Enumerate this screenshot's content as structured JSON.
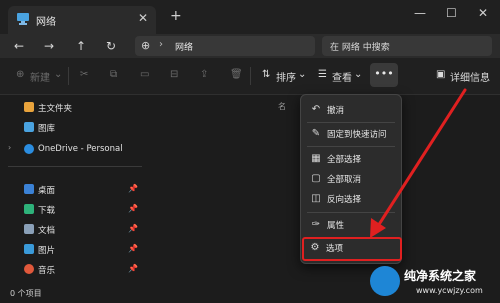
{
  "window": {
    "tab_title": "网络",
    "tab_icon": "network-icon",
    "new_tab": "+",
    "controls": {
      "minimize": "—",
      "maximize": "☐",
      "close": "✕"
    }
  },
  "address": {
    "path": "网络",
    "search_placeholder": "在 网络 中搜索"
  },
  "toolbar": {
    "new_label": "新建",
    "sort_label": "排序",
    "view_label": "查看",
    "more_label": "•••",
    "details_label": "详细信息"
  },
  "sidebar": {
    "items": [
      {
        "label": "主文件夹",
        "icon": "home-icon",
        "color": "#e8a33c"
      },
      {
        "label": "图库",
        "icon": "gallery-icon",
        "color": "#4aa3e0"
      },
      {
        "label": "OneDrive - Personal",
        "icon": "cloud-icon",
        "color": "#2b8de0"
      },
      {
        "label": "桌面",
        "icon": "desktop-icon",
        "color": "#3b82d6"
      },
      {
        "label": "下载",
        "icon": "download-icon",
        "color": "#2eb27a"
      },
      {
        "label": "文档",
        "icon": "document-icon",
        "color": "#8aa0b8"
      },
      {
        "label": "图片",
        "icon": "picture-icon",
        "color": "#3a9ad9"
      },
      {
        "label": "音乐",
        "icon": "music-icon",
        "color": "#e0583b"
      }
    ]
  },
  "main": {
    "column_header": "名"
  },
  "menu": {
    "items": [
      {
        "label": "撤消",
        "icon": "undo-icon"
      },
      {
        "label": "固定到快速访问",
        "icon": "pin-icon"
      },
      {
        "label": "全部选择",
        "icon": "select-all-icon"
      },
      {
        "label": "全部取消",
        "icon": "select-none-icon"
      },
      {
        "label": "反向选择",
        "icon": "invert-selection-icon"
      },
      {
        "label": "属性",
        "icon": "properties-icon"
      },
      {
        "label": "选项",
        "icon": "gear-icon"
      }
    ]
  },
  "status": {
    "count": "0 个项目"
  },
  "watermark": {
    "title": "纯净系统之家",
    "url": "www.ycwjzy.com"
  }
}
